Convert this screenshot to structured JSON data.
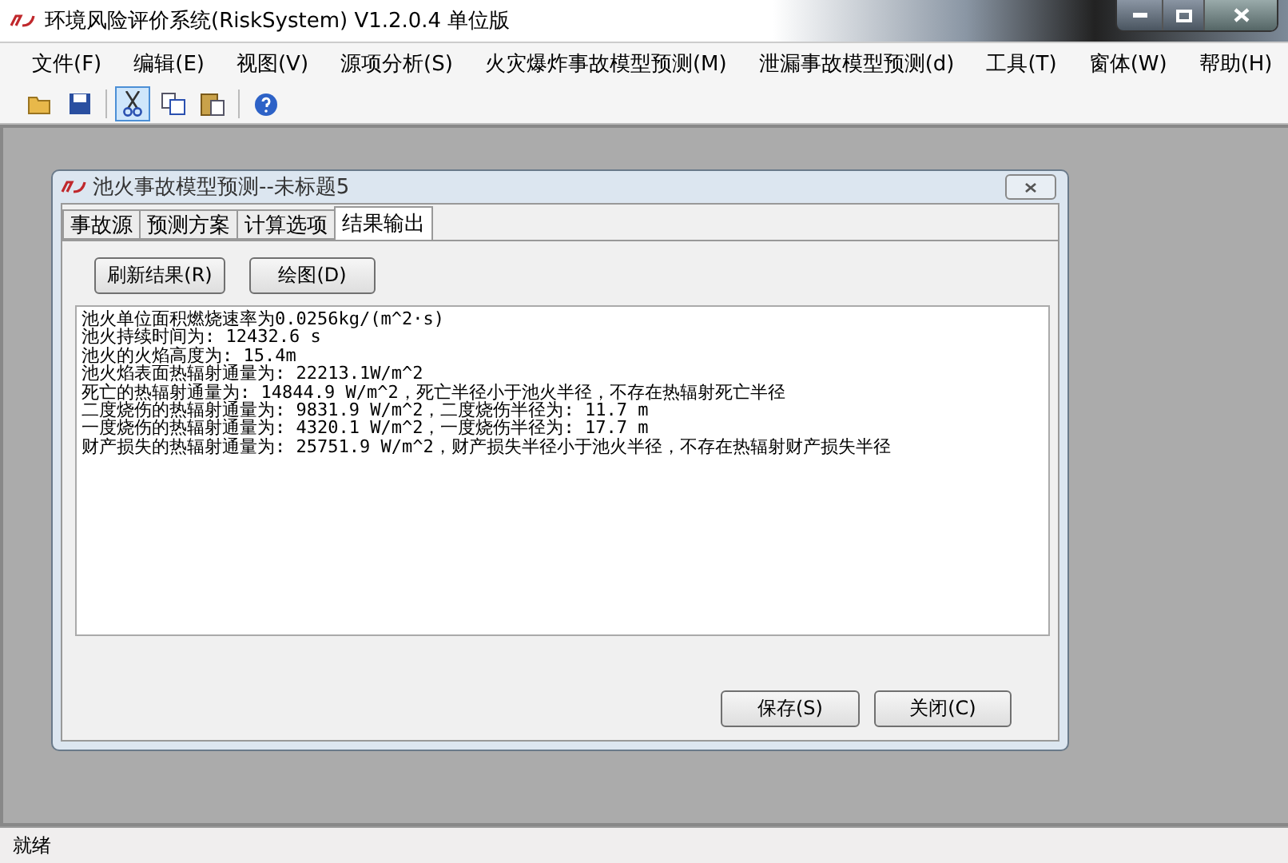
{
  "window": {
    "title": "环境风险评价系统(RiskSystem) V1.2.0.4 单位版"
  },
  "menu": [
    "文件(F)",
    "编辑(E)",
    "视图(V)",
    "源项分析(S)",
    "火灾爆炸事故模型预测(M)",
    "泄漏事故模型预测(d)",
    "工具(T)",
    "窗体(W)",
    "帮助(H)"
  ],
  "toolbar": [
    {
      "kind": "open",
      "selected": false
    },
    {
      "kind": "save",
      "selected": false
    },
    {
      "kind": "cut",
      "selected": true
    },
    {
      "kind": "copy",
      "selected": false
    },
    {
      "kind": "paste",
      "selected": false
    },
    {
      "kind": "help",
      "selected": false
    }
  ],
  "child_window": {
    "title": "池火事故模型预测--未标题5",
    "tabs": [
      {
        "label": "事故源",
        "selected": false
      },
      {
        "label": "预测方案",
        "selected": false
      },
      {
        "label": "计算选项",
        "selected": false
      },
      {
        "label": "结果输出",
        "selected": true
      }
    ],
    "buttons": [
      "刷新结果(R)",
      "绘图(D)"
    ],
    "output_lines": [
      "池火单位面积燃烧速率为0.0256kg/(m^2·s)",
      "池火持续时间为: 12432.6 s",
      "池火的火焰高度为: 15.4m",
      "池火焰表面热辐射通量为: 22213.1W/m^2",
      "死亡的热辐射通量为: 14844.9 W/m^2，死亡半径小于池火半径，不存在热辐射死亡半径",
      "二度烧伤的热辐射通量为: 9831.9 W/m^2，二度烧伤半径为: 11.7 m",
      "一度烧伤的热辐射通量为: 4320.1 W/m^2，一度烧伤半径为: 17.7 m",
      "财产损失的热辐射通量为: 25751.9 W/m^2，财产损失半径小于池火半径，不存在热辐射财产损失半径"
    ],
    "footer_buttons": [
      "保存(S)",
      "关闭(C)"
    ]
  },
  "status_bar": "就绪"
}
